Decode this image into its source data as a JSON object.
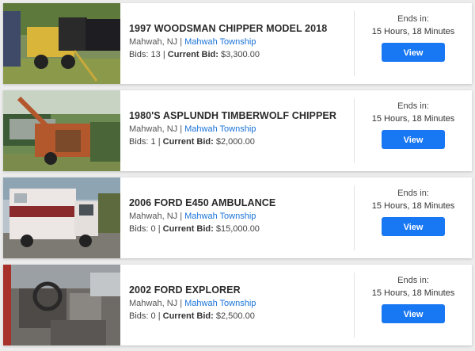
{
  "listings": [
    {
      "title": "1997 WOODSMAN CHIPPER MODEL 2018",
      "city": "Mahwah, NJ",
      "separator": " | ",
      "seller": "Mahwah Township",
      "bids_label": "Bids:",
      "bids": "13",
      "current_label": "Current Bid:",
      "current_bid": "$3,300.00",
      "ends_label": "Ends in:",
      "ends_time": "15 Hours, 18 Minutes",
      "button": "View"
    },
    {
      "title": "1980'S ASPLUNDH TIMBERWOLF CHIPPER",
      "city": "Mahwah, NJ",
      "separator": " | ",
      "seller": "Mahwah Township",
      "bids_label": "Bids:",
      "bids": "1",
      "current_label": "Current Bid:",
      "current_bid": "$2,000.00",
      "ends_label": "Ends in:",
      "ends_time": "15 Hours, 18 Minutes",
      "button": "View"
    },
    {
      "title": "2006 FORD E450 AMBULANCE",
      "city": "Mahwah, NJ",
      "separator": " | ",
      "seller": "Mahwah Township",
      "bids_label": "Bids:",
      "bids": "0",
      "current_label": "Current Bid:",
      "current_bid": "$15,000.00",
      "ends_label": "Ends in:",
      "ends_time": "15 Hours, 18 Minutes",
      "button": "View"
    },
    {
      "title": "2002 FORD EXPLORER",
      "city": "Mahwah, NJ",
      "separator": " | ",
      "seller": "Mahwah Township",
      "bids_label": "Bids:",
      "bids": "0",
      "current_label": "Current Bid:",
      "current_bid": "$2,500.00",
      "ends_label": "Ends in:",
      "ends_time": "15 Hours, 18 Minutes",
      "button": "View"
    }
  ],
  "colors": {
    "accent": "#1877f2",
    "link": "#1a73d9",
    "title": "#2a2a2a",
    "background": "#ececec"
  }
}
